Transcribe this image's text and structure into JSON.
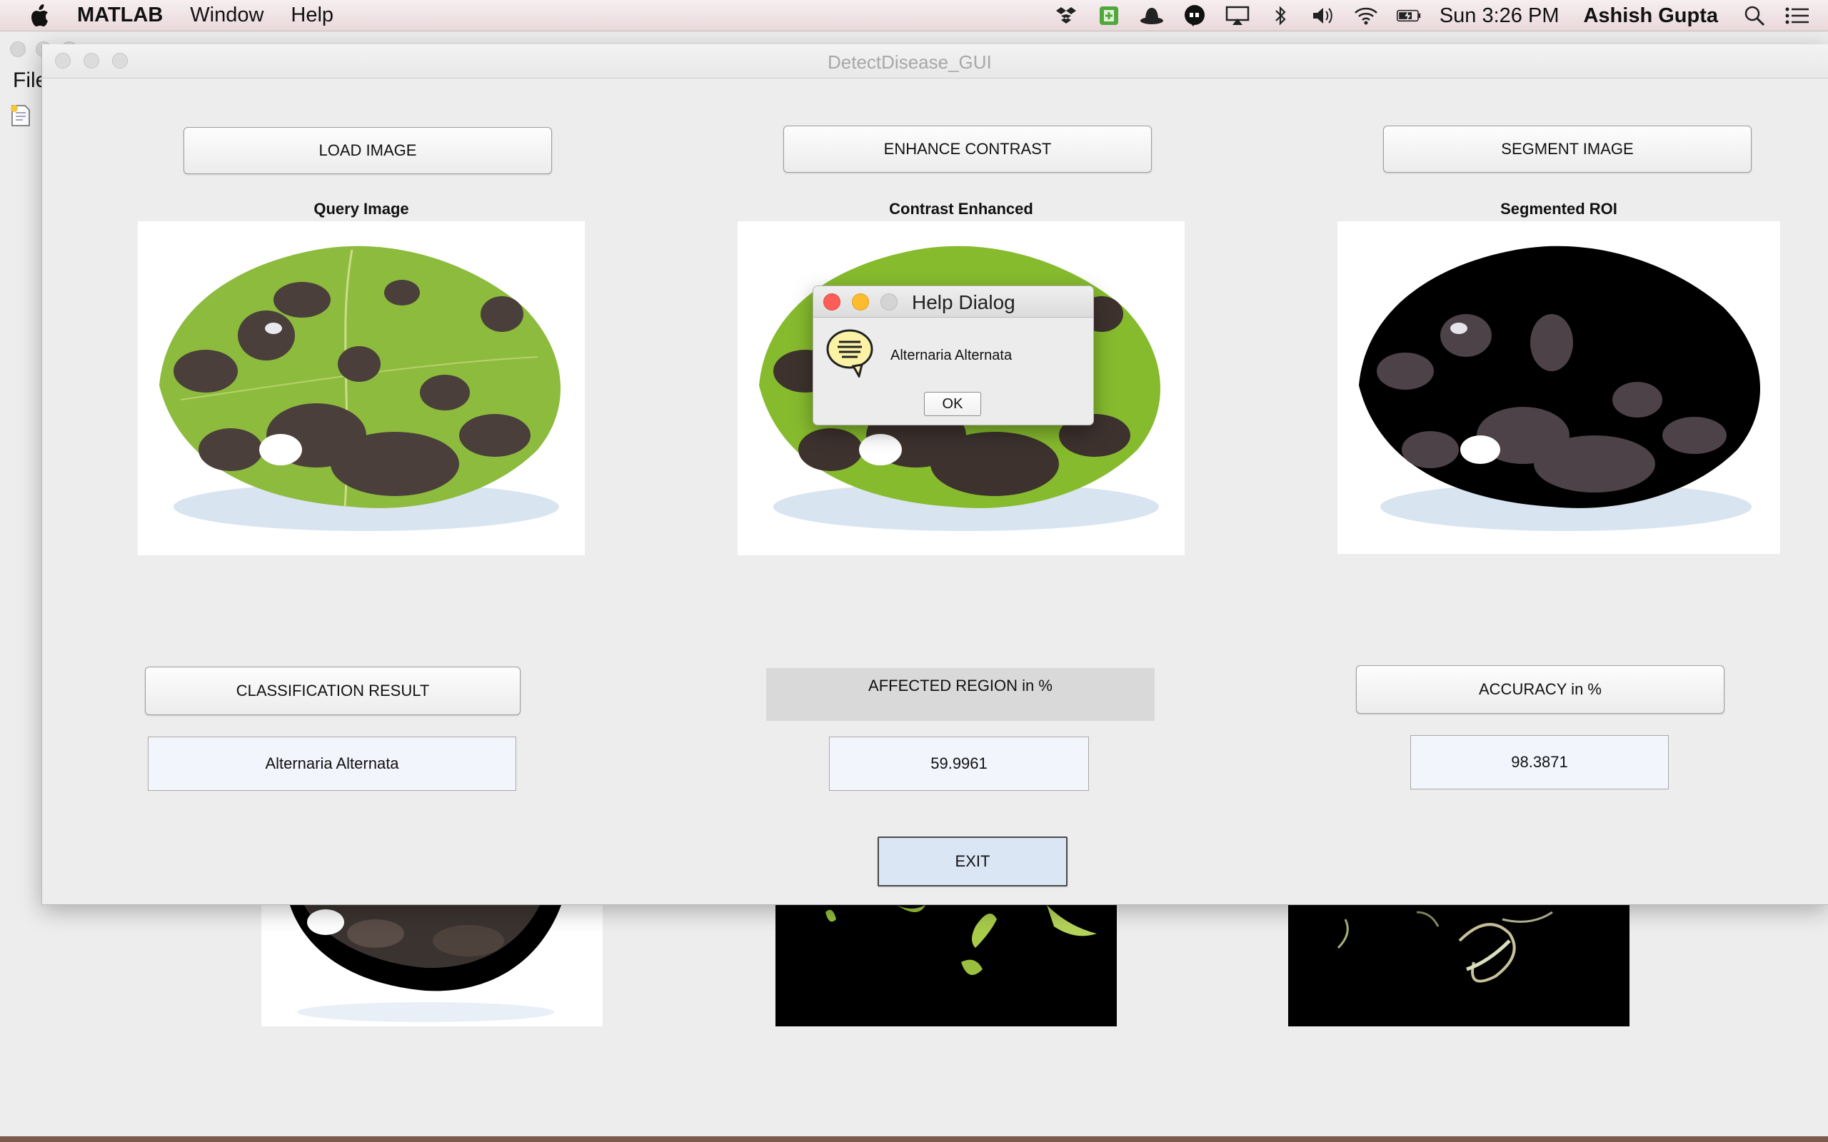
{
  "menubar": {
    "app_name": "MATLAB",
    "menus": [
      "Window",
      "Help"
    ],
    "clock": "Sun 3:26 PM",
    "user": "Ashish Gupta"
  },
  "background_window": {
    "file_menu": "File"
  },
  "gui": {
    "window_title": "DetectDisease_GUI",
    "load_button": "LOAD IMAGE",
    "enhance_button": "ENHANCE CONTRAST",
    "segment_button": "SEGMENT IMAGE",
    "query_label": "Query Image",
    "contrast_label": "Contrast Enhanced",
    "segmented_label": "Segmented ROI",
    "classification_button": "CLASSIFICATION RESULT",
    "affected_label": "AFFECTED REGION in %",
    "accuracy_button": "ACCURACY in %",
    "classification_value": "Alternaria Alternata",
    "affected_value": "59.9961",
    "accuracy_value": "98.3871",
    "exit_button": "EXIT"
  },
  "dialog": {
    "title": "Help Dialog",
    "message": "Alternaria Alternata",
    "ok_label": "OK"
  },
  "colors": {
    "leaf_green": "#8dbb3d",
    "lesion_brown": "#4a3f3a",
    "exit_button_bg": "#dbe6f5",
    "close_red": "#fc5e57",
    "minimize_yellow": "#fdbc2e"
  }
}
